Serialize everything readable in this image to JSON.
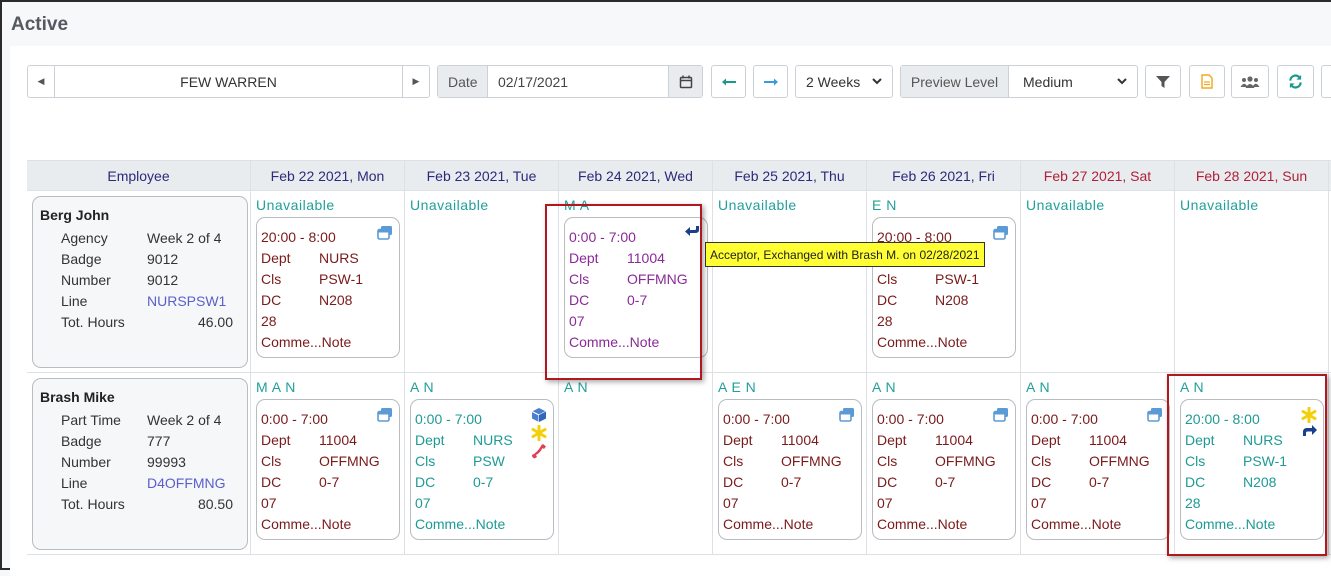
{
  "page_title": "Active",
  "toolbar": {
    "employee_name": "FEW WARREN",
    "date_label": "Date",
    "date_value": "02/17/2021",
    "period_value": "2 Weeks",
    "preview_label": "Preview Level",
    "preview_value": "Medium"
  },
  "colors": {
    "header_text": "#2a2a7a",
    "weekend_text": "#b0203a",
    "available_text": "#1d9a96",
    "highlight_border": "#b01820",
    "tooltip_bg": "#ffff33"
  },
  "grid": {
    "employee_header": "Employee",
    "days": [
      {
        "label": "Feb 22 2021, Mon",
        "weekend": false
      },
      {
        "label": "Feb 23 2021, Tue",
        "weekend": false
      },
      {
        "label": "Feb 24 2021, Wed",
        "weekend": false
      },
      {
        "label": "Feb 25 2021, Thu",
        "weekend": false
      },
      {
        "label": "Feb 26 2021, Fri",
        "weekend": false
      },
      {
        "label": "Feb 27 2021, Sat",
        "weekend": true
      },
      {
        "label": "Feb 28 2021, Sun",
        "weekend": true
      }
    ],
    "employees": [
      {
        "name": "Berg John",
        "type": "Agency",
        "week": "Week 2 of 4",
        "badge_label": "Badge",
        "badge": "9012",
        "number_label": "Number",
        "number": "9012",
        "line_label": "Line",
        "line": "NURSPSW1",
        "hours_label": "Tot. Hours",
        "hours": "46.00",
        "days": [
          {
            "avail": "Unavailable",
            "shift": {
              "time": "20:00 - 8:00",
              "dept": "NURS",
              "cls": "PSW-1",
              "dc": "N208",
              "code": "28",
              "comment": "Comme...Note"
            }
          },
          {
            "avail": "Unavailable"
          },
          {
            "avail": "M A",
            "shift": {
              "time": "0:00 - 7:00",
              "dept": "11004",
              "cls": "OFFMNG",
              "dc": "0-7",
              "code": "07",
              "comment": "Comme...Note"
            }
          },
          {
            "avail": "Unavailable"
          },
          {
            "avail": "E N",
            "shift": {
              "time": "20:00 - 8:00",
              "dept": "NURS",
              "cls": "PSW-1",
              "dc": "N208",
              "code": "28",
              "comment": "Comme...Note"
            }
          },
          {
            "avail": "Unavailable"
          },
          {
            "avail": "Unavailable"
          }
        ]
      },
      {
        "name": "Brash Mike",
        "type": "Part Time",
        "week": "Week 2 of 4",
        "badge_label": "Badge",
        "badge": "777",
        "number_label": "Number",
        "number": "99993",
        "line_label": "Line",
        "line": "D4OFFMNG",
        "hours_label": "Tot. Hours",
        "hours": "80.50",
        "days": [
          {
            "avail": "M A N",
            "shift": {
              "time": "0:00 - 7:00",
              "dept": "11004",
              "cls": "OFFMNG",
              "dc": "0-7",
              "code": "07",
              "comment": "Comme...Note"
            }
          },
          {
            "avail": "A N",
            "shift": {
              "time": "0:00 - 7:00",
              "dept": "NURS",
              "cls": "PSW",
              "dc": "0-7",
              "code": "07",
              "comment": "Comme...Note"
            }
          },
          {
            "avail": "A N"
          },
          {
            "avail": "A E N",
            "shift": {
              "time": "0:00 - 7:00",
              "dept": "11004",
              "cls": "OFFMNG",
              "dc": "0-7",
              "code": "07",
              "comment": "Comme...Note"
            }
          },
          {
            "avail": "A N",
            "shift": {
              "time": "0:00 - 7:00",
              "dept": "11004",
              "cls": "OFFMNG",
              "dc": "0-7",
              "code": "07",
              "comment": "Comme...Note"
            }
          },
          {
            "avail": "A N",
            "shift": {
              "time": "0:00 - 7:00",
              "dept": "11004",
              "cls": "OFFMNG",
              "dc": "0-7",
              "code": "07",
              "comment": "Comme...Note"
            }
          },
          {
            "avail": "A N",
            "shift": {
              "time": "20:00 - 8:00",
              "dept": "NURS",
              "cls": "PSW-1",
              "dc": "N208",
              "code": "28",
              "comment": "Comme...Note"
            }
          }
        ]
      }
    ],
    "field_labels": {
      "dept": "Dept",
      "cls": "Cls",
      "dc": "DC"
    }
  },
  "tooltip": "Acceptor, Exchanged with Brash M. on 02/28/2021"
}
